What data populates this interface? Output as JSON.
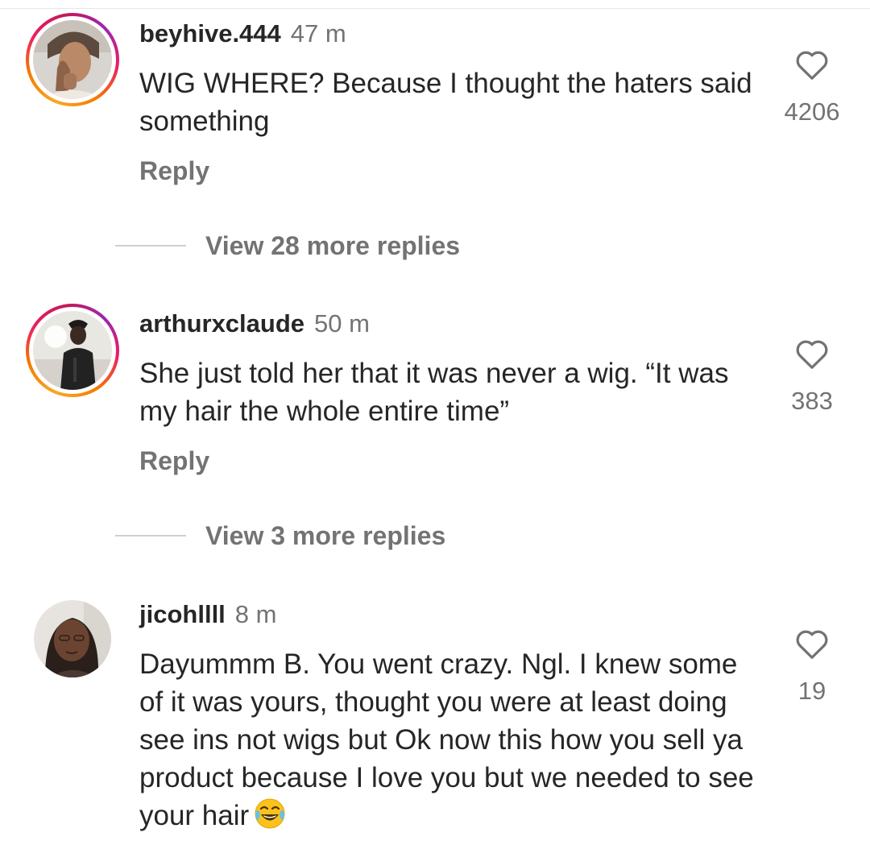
{
  "comments": [
    {
      "username": "beyhive.444",
      "time": "47 m",
      "text": "WIG WHERE? Because I thought the haters said something",
      "likes": "4206",
      "reply_label": "Reply",
      "view_replies": "View 28 more replies",
      "has_story_ring": true
    },
    {
      "username": "arthurxclaude",
      "time": "50 m",
      "text": "She just told her that it was never a wig. “It was my hair the whole entire time”",
      "likes": "383",
      "reply_label": "Reply",
      "view_replies": "View 3 more replies",
      "has_story_ring": true
    },
    {
      "username": "jicohllll",
      "time": "8 m",
      "text": "Dayummm B. You went crazy. Ngl. I knew some of it was yours, thought you were at least doing see ins not wigs but Ok now this how you sell ya product because I love you but we needed to see your hair",
      "likes": "19",
      "has_story_ring": false
    }
  ],
  "icons": {
    "like": "heart-outline-icon",
    "emoji": "face-with-tears-of-joy-icon"
  },
  "colors": {
    "text": "#262626",
    "secondary": "#737373",
    "ring_start": "#f9a825",
    "ring_end": "#c2185b"
  }
}
